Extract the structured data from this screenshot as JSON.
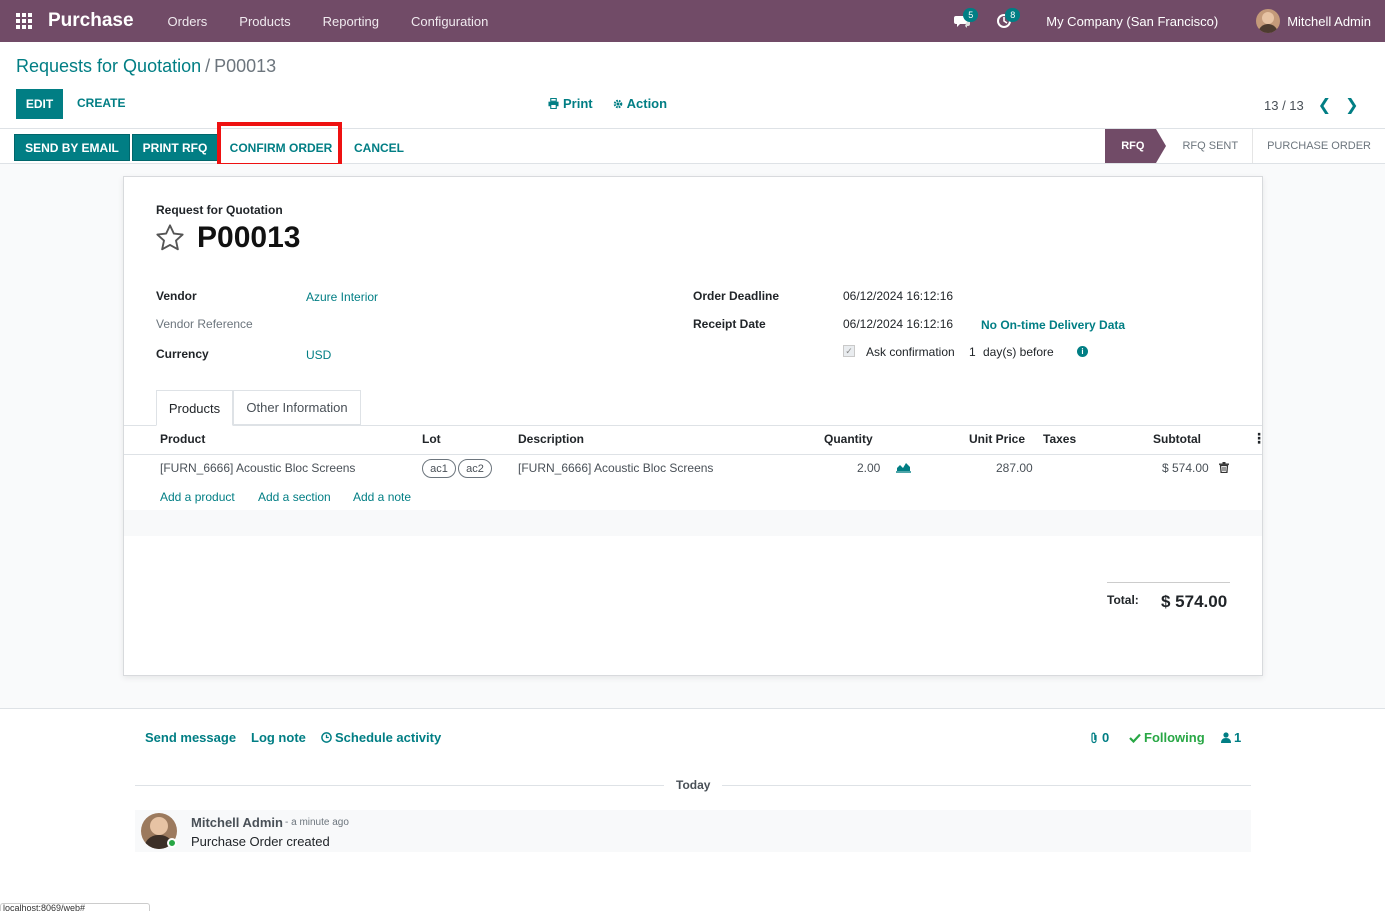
{
  "navbar": {
    "app_name": "Purchase",
    "menu": [
      "Orders",
      "Products",
      "Reporting",
      "Configuration"
    ],
    "messages_badge": "5",
    "activities_badge": "8",
    "company": "My Company (San Francisco)",
    "user": "Mitchell Admin",
    "bg_color": "#714b67"
  },
  "breadcrumb": {
    "parent": "Requests for Quotation",
    "separator": "/",
    "current": "P00013"
  },
  "toolbar": {
    "edit": "EDIT",
    "create": "CREATE",
    "print": "Print",
    "action": "Action",
    "pager": "13 / 13"
  },
  "statusbar": {
    "buttons": [
      "SEND BY EMAIL",
      "PRINT RFQ",
      "CONFIRM ORDER",
      "CANCEL"
    ],
    "stages": [
      "RFQ",
      "RFQ SENT",
      "PURCHASE ORDER"
    ],
    "active_stage": "RFQ"
  },
  "form": {
    "doc_type": "Request for Quotation",
    "name": "P00013",
    "vendor_label": "Vendor",
    "vendor": "Azure Interior",
    "vendor_ref_label": "Vendor Reference",
    "currency_label": "Currency",
    "currency": "USD",
    "order_deadline_label": "Order Deadline",
    "order_deadline": "06/12/2024 16:12:16",
    "receipt_date_label": "Receipt Date",
    "receipt_date": "06/12/2024 16:12:16",
    "delivery_data": "No On-time Delivery Data",
    "ask_confirmation": "Ask confirmation",
    "ask_days": "1",
    "ask_suffix": "day(s) before"
  },
  "tabs": [
    "Products",
    "Other Information"
  ],
  "table": {
    "headers": [
      "Product",
      "Lot",
      "Description",
      "Quantity",
      "Unit Price",
      "Taxes",
      "Subtotal"
    ],
    "rows": [
      {
        "product": "[FURN_6666] Acoustic Bloc Screens",
        "lots": [
          "ac1",
          "ac2"
        ],
        "description": "[FURN_6666] Acoustic Bloc Screens",
        "quantity": "2.00",
        "unit_price": "287.00",
        "taxes": "",
        "subtotal": "$ 574.00"
      }
    ],
    "add_links": [
      "Add a product",
      "Add a section",
      "Add a note"
    ],
    "total_label": "Total:",
    "total": "$ 574.00"
  },
  "chatter": {
    "send_message": "Send message",
    "log_note": "Log note",
    "schedule_activity": "Schedule activity",
    "attachments": "0",
    "following": "Following",
    "followers": "1",
    "date_separator": "Today",
    "message": {
      "author": "Mitchell Admin",
      "time": "- a minute ago",
      "body": "Purchase Order created"
    }
  },
  "status_url": "localhost:8069/web#"
}
